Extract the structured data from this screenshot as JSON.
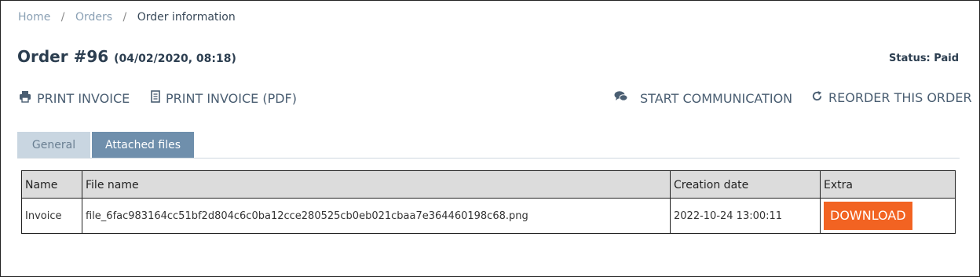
{
  "breadcrumb": {
    "home": "Home",
    "separator": "/",
    "orders": "Orders",
    "current": "Order information"
  },
  "order": {
    "title": "Order #96",
    "datetime": "(04/02/2020, 08:18)",
    "status": "Status: Paid"
  },
  "actions": {
    "print_invoice": "PRINT INVOICE",
    "print_invoice_pdf": "PRINT INVOICE (PDF)",
    "start_communication": "START COMMUNICATION",
    "reorder": "REORDER THIS ORDER"
  },
  "tabs": [
    {
      "label": "General",
      "active": false
    },
    {
      "label": "Attached files",
      "active": true
    }
  ],
  "files_table": {
    "headers": [
      "Name",
      "File name",
      "Creation date",
      "Extra"
    ],
    "rows": [
      {
        "name": "Invoice",
        "file_name": "file_6fac983164cc51bf2d804c6c0ba12cce280525cb0eb021cbaa7e364460198c68.png",
        "creation_date": "2022-10-24 13:00:11",
        "extra_button": "DOWNLOAD"
      }
    ]
  },
  "colors": {
    "accent_tab": "#6f8fac",
    "inactive_tab": "#c9d6e1",
    "download_button": "#f26322",
    "link": "#8aa0b4"
  },
  "icons": {
    "print": "printer-icon",
    "pdf": "document-icon",
    "communication": "chat-bubbles-icon",
    "reorder": "refresh-icon"
  }
}
